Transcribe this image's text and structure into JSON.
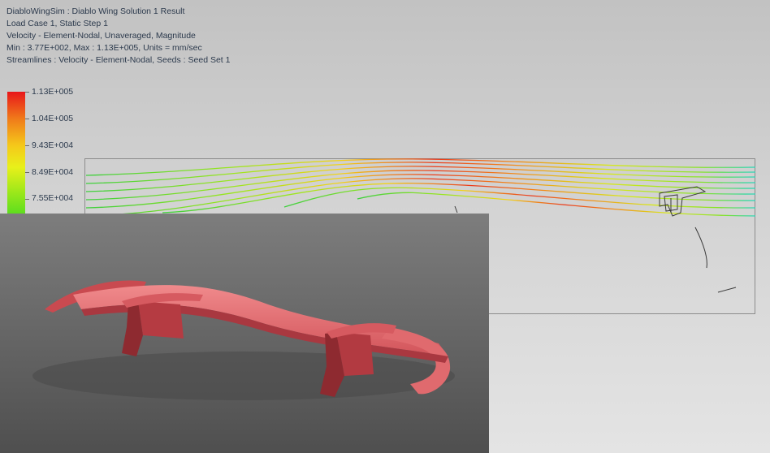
{
  "result_header": {
    "line1": "DiabloWingSim : Diablo Wing Solution 1 Result",
    "line2": "Load Case 1, Static Step 1",
    "line3": "Velocity - Element-Nodal, Unaveraged, Magnitude",
    "line4": "Min : 3.77E+002, Max : 1.13E+005, Units = mm/sec",
    "line5": "Streamlines : Velocity - Element-Nodal, Seeds : Seed Set 1"
  },
  "legend": {
    "labels": [
      "1.13E+005",
      "1.04E+005",
      "9.43E+004",
      "8.49E+004",
      "7.55E+004"
    ],
    "colors": [
      "#e8161a",
      "#f07a1a",
      "#f5c81a",
      "#e8f01a",
      "#9ee81a",
      "#5ede1e"
    ]
  },
  "render": {
    "wing_color": "#d95a5e",
    "background_color": "#6b6b6b"
  }
}
